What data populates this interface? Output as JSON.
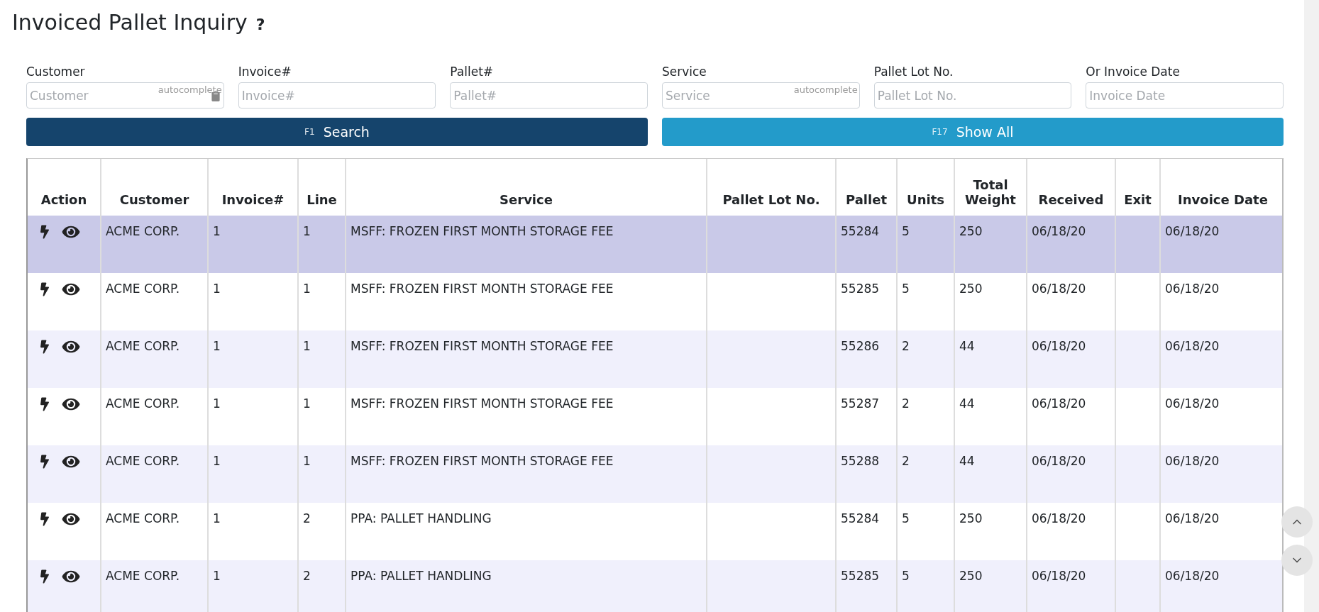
{
  "title": "Invoiced Pallet Inquiry",
  "help": "?",
  "filters": [
    {
      "label": "Customer",
      "placeholder": "Customer",
      "kind": "autocomplete",
      "hint": "autocomplete",
      "icon": true
    },
    {
      "label": "Invoice#",
      "placeholder": "Invoice#",
      "kind": "text"
    },
    {
      "label": "Pallet#",
      "placeholder": "Pallet#",
      "kind": "text"
    },
    {
      "label": "Service",
      "placeholder": "Service",
      "kind": "autocomplete",
      "hint": "autocomplete",
      "icon": false
    },
    {
      "label": "Pallet Lot No.",
      "placeholder": "Pallet Lot No.",
      "kind": "text"
    },
    {
      "label": "Or Invoice Date",
      "placeholder": "Invoice Date",
      "kind": "text"
    }
  ],
  "buttons": [
    {
      "key": "F1",
      "label": "Search",
      "kind": "primary"
    },
    {
      "key": "F17",
      "label": "Show All",
      "kind": "secondary"
    }
  ],
  "table": {
    "columns": [
      "Action",
      "Customer",
      "Invoice#",
      "Line",
      "Service",
      "Pallet Lot No.",
      "Pallet",
      "Units",
      "Total Weight",
      "Received",
      "Exit",
      "Invoice Date"
    ],
    "rows": [
      {
        "selected": true,
        "customer": "ACME CORP.",
        "invoice": "1",
        "line": "1",
        "service": "MSFF: FROZEN FIRST MONTH STORAGE FEE",
        "pallet": "55284",
        "units": "5",
        "total_weight": "250",
        "received": "06/18/20",
        "invoice_date": "06/18/20"
      },
      {
        "selected": false,
        "customer": "ACME CORP.",
        "invoice": "1",
        "line": "1",
        "service": "MSFF: FROZEN FIRST MONTH STORAGE FEE",
        "pallet": "55285",
        "units": "5",
        "total_weight": "250",
        "received": "06/18/20",
        "invoice_date": "06/18/20"
      },
      {
        "selected": false,
        "customer": "ACME CORP.",
        "invoice": "1",
        "line": "1",
        "service": "MSFF: FROZEN FIRST MONTH STORAGE FEE",
        "pallet": "55286",
        "units": "2",
        "total_weight": "44",
        "received": "06/18/20",
        "invoice_date": "06/18/20"
      },
      {
        "selected": false,
        "customer": "ACME CORP.",
        "invoice": "1",
        "line": "1",
        "service": "MSFF: FROZEN FIRST MONTH STORAGE FEE",
        "pallet": "55287",
        "units": "2",
        "total_weight": "44",
        "received": "06/18/20",
        "invoice_date": "06/18/20"
      },
      {
        "selected": false,
        "customer": "ACME CORP.",
        "invoice": "1",
        "line": "1",
        "service": "MSFF: FROZEN FIRST MONTH STORAGE FEE",
        "pallet": "55288",
        "units": "2",
        "total_weight": "44",
        "received": "06/18/20",
        "invoice_date": "06/18/20"
      },
      {
        "selected": false,
        "customer": "ACME CORP.",
        "invoice": "1",
        "line": "2",
        "service": "PPA: PALLET HANDLING",
        "pallet": "55284",
        "units": "5",
        "total_weight": "250",
        "received": "06/18/20",
        "invoice_date": "06/18/20"
      },
      {
        "selected": false,
        "customer": "ACME CORP.",
        "invoice": "1",
        "line": "2",
        "service": "PPA: PALLET HANDLING",
        "pallet": "55285",
        "units": "5",
        "total_weight": "250",
        "received": "06/18/20",
        "invoice_date": "06/18/20"
      }
    ]
  }
}
